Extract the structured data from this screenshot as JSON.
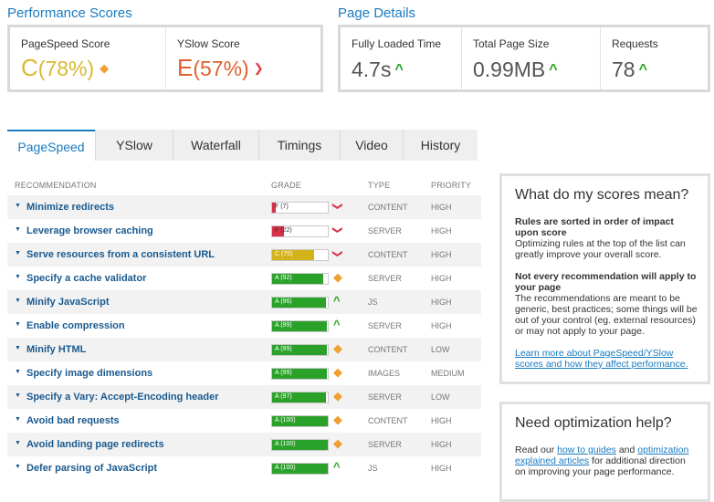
{
  "performance_scores": {
    "title": "Performance Scores",
    "pagespeed": {
      "label": "PageSpeed Score",
      "grade": "C",
      "percent": "(78%)",
      "color": "#e2c23a"
    },
    "yslow": {
      "label": "YSlow Score",
      "grade": "E",
      "percent": "(57%)",
      "color": "#e06030"
    }
  },
  "page_details": {
    "title": "Page Details",
    "fully_loaded": {
      "label": "Fully Loaded Time",
      "value": "4.7s"
    },
    "total_size": {
      "label": "Total Page Size",
      "value": "0.99MB"
    },
    "requests": {
      "label": "Requests",
      "value": "78"
    }
  },
  "tabs": [
    {
      "label": "PageSpeed",
      "active": true
    },
    {
      "label": "YSlow",
      "active": false
    },
    {
      "label": "Waterfall",
      "active": false
    },
    {
      "label": "Timings",
      "active": false
    },
    {
      "label": "Video",
      "active": false
    },
    {
      "label": "History",
      "active": false
    }
  ],
  "table": {
    "headers": {
      "recommendation": "RECOMMENDATION",
      "grade": "GRADE",
      "type": "TYPE",
      "priority": "PRIORITY"
    },
    "rows": [
      {
        "name": "Minimize redirects",
        "grade_text": "F (7)",
        "score": 7,
        "color": "#d9304a",
        "indicator": "down",
        "type": "CONTENT",
        "priority": "HIGH"
      },
      {
        "name": "Leverage browser caching",
        "grade_text": "F (22)",
        "score": 22,
        "color": "#d9304a",
        "indicator": "down",
        "type": "SERVER",
        "priority": "HIGH"
      },
      {
        "name": "Serve resources from a consistent URL",
        "grade_text": "C (75)",
        "score": 75,
        "color": "#d4b21a",
        "indicator": "down",
        "type": "CONTENT",
        "priority": "HIGH"
      },
      {
        "name": "Specify a cache validator",
        "grade_text": "A (92)",
        "score": 92,
        "color": "#2aa22a",
        "indicator": "mid",
        "type": "SERVER",
        "priority": "HIGH"
      },
      {
        "name": "Minify JavaScript",
        "grade_text": "A (96)",
        "score": 96,
        "color": "#2aa22a",
        "indicator": "up",
        "type": "JS",
        "priority": "HIGH"
      },
      {
        "name": "Enable compression",
        "grade_text": "A (99)",
        "score": 99,
        "color": "#2aa22a",
        "indicator": "up",
        "type": "SERVER",
        "priority": "HIGH"
      },
      {
        "name": "Minify HTML",
        "grade_text": "A (99)",
        "score": 99,
        "color": "#2aa22a",
        "indicator": "mid",
        "type": "CONTENT",
        "priority": "LOW"
      },
      {
        "name": "Specify image dimensions",
        "grade_text": "A (99)",
        "score": 99,
        "color": "#2aa22a",
        "indicator": "mid",
        "type": "IMAGES",
        "priority": "MEDIUM"
      },
      {
        "name": "Specify a Vary: Accept-Encoding header",
        "grade_text": "A (97)",
        "score": 97,
        "color": "#2aa22a",
        "indicator": "mid",
        "type": "SERVER",
        "priority": "LOW"
      },
      {
        "name": "Avoid bad requests",
        "grade_text": "A (100)",
        "score": 100,
        "color": "#2aa22a",
        "indicator": "mid",
        "type": "CONTENT",
        "priority": "HIGH"
      },
      {
        "name": "Avoid landing page redirects",
        "grade_text": "A (100)",
        "score": 100,
        "color": "#2aa22a",
        "indicator": "mid",
        "type": "SERVER",
        "priority": "HIGH"
      },
      {
        "name": "Defer parsing of JavaScript",
        "grade_text": "A (100)",
        "score": 100,
        "color": "#2aa22a",
        "indicator": "up",
        "type": "JS",
        "priority": "HIGH"
      }
    ]
  },
  "scores_box": {
    "title": "What do my scores mean?",
    "p1_bold": "Rules are sorted in order of impact upon score",
    "p1": "Optimizing rules at the top of the list can greatly improve your overall score.",
    "p2_bold": "Not every recommendation will apply to your page",
    "p2": "The recommendations are meant to be generic, best practices; some things will be out of your control (eg. external resources) or may not apply to your page.",
    "link": "Learn more about PageSpeed/YSlow scores and how they affect performance."
  },
  "help_box": {
    "title": "Need optimization help?",
    "pre": "Read our ",
    "link1": "how to guides",
    "mid": " and ",
    "link2": "optimization explained articles",
    "post": " for additional direction on improving your page performance."
  },
  "icons": {
    "down": "chevron-down-icon",
    "up": "chevron-up-icon",
    "mid": "diamond-icon"
  }
}
